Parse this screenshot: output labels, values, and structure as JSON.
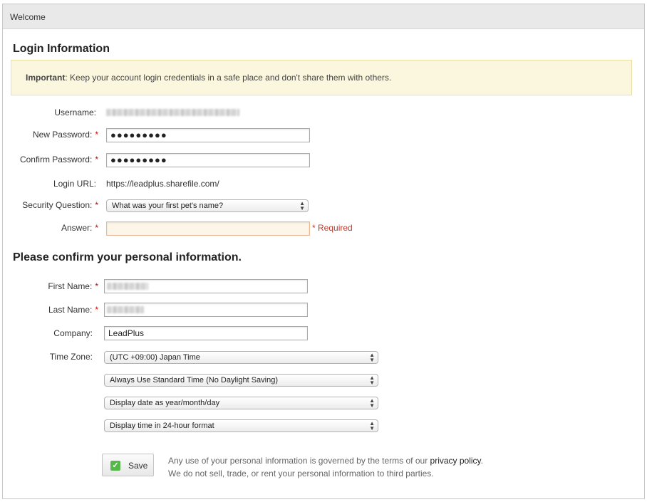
{
  "panel": {
    "title": "Welcome"
  },
  "login": {
    "heading": "Login Information",
    "notice": {
      "strong": "Important",
      "text": ": Keep your account login credentials in a safe place and don't share them with others."
    },
    "username_label": "Username:",
    "new_password_label": "New Password:",
    "new_password_value": "●●●●●●●●●",
    "confirm_password_label": "Confirm Password:",
    "confirm_password_value": "●●●●●●●●●",
    "login_url_label": "Login URL:",
    "login_url_value": "https://leadplus.sharefile.com/",
    "security_question_label": "Security Question:",
    "security_question_value": "What was your first pet's name?",
    "answer_label": "Answer:",
    "answer_value": "",
    "required_msg": "* Required",
    "required_mark": "*"
  },
  "personal": {
    "heading": "Please confirm your personal information.",
    "first_name_label": "First Name:",
    "last_name_label": "Last Name:",
    "company_label": "Company:",
    "company_value": "LeadPlus",
    "timezone_label": "Time Zone:",
    "timezone_value": "(UTC +09:00) Japan Time",
    "dst_value": "Always Use Standard Time (No Daylight Saving)",
    "date_format_value": "Display date as year/month/day",
    "time_format_value": "Display time in 24-hour format"
  },
  "footer": {
    "save_label": "Save",
    "privacy_prefix": "Any use of your personal information is governed by the terms of our ",
    "privacy_link": "privacy policy",
    "privacy_suffix": ".",
    "no_sell": "We do not sell, trade, or rent your personal information to third parties."
  }
}
